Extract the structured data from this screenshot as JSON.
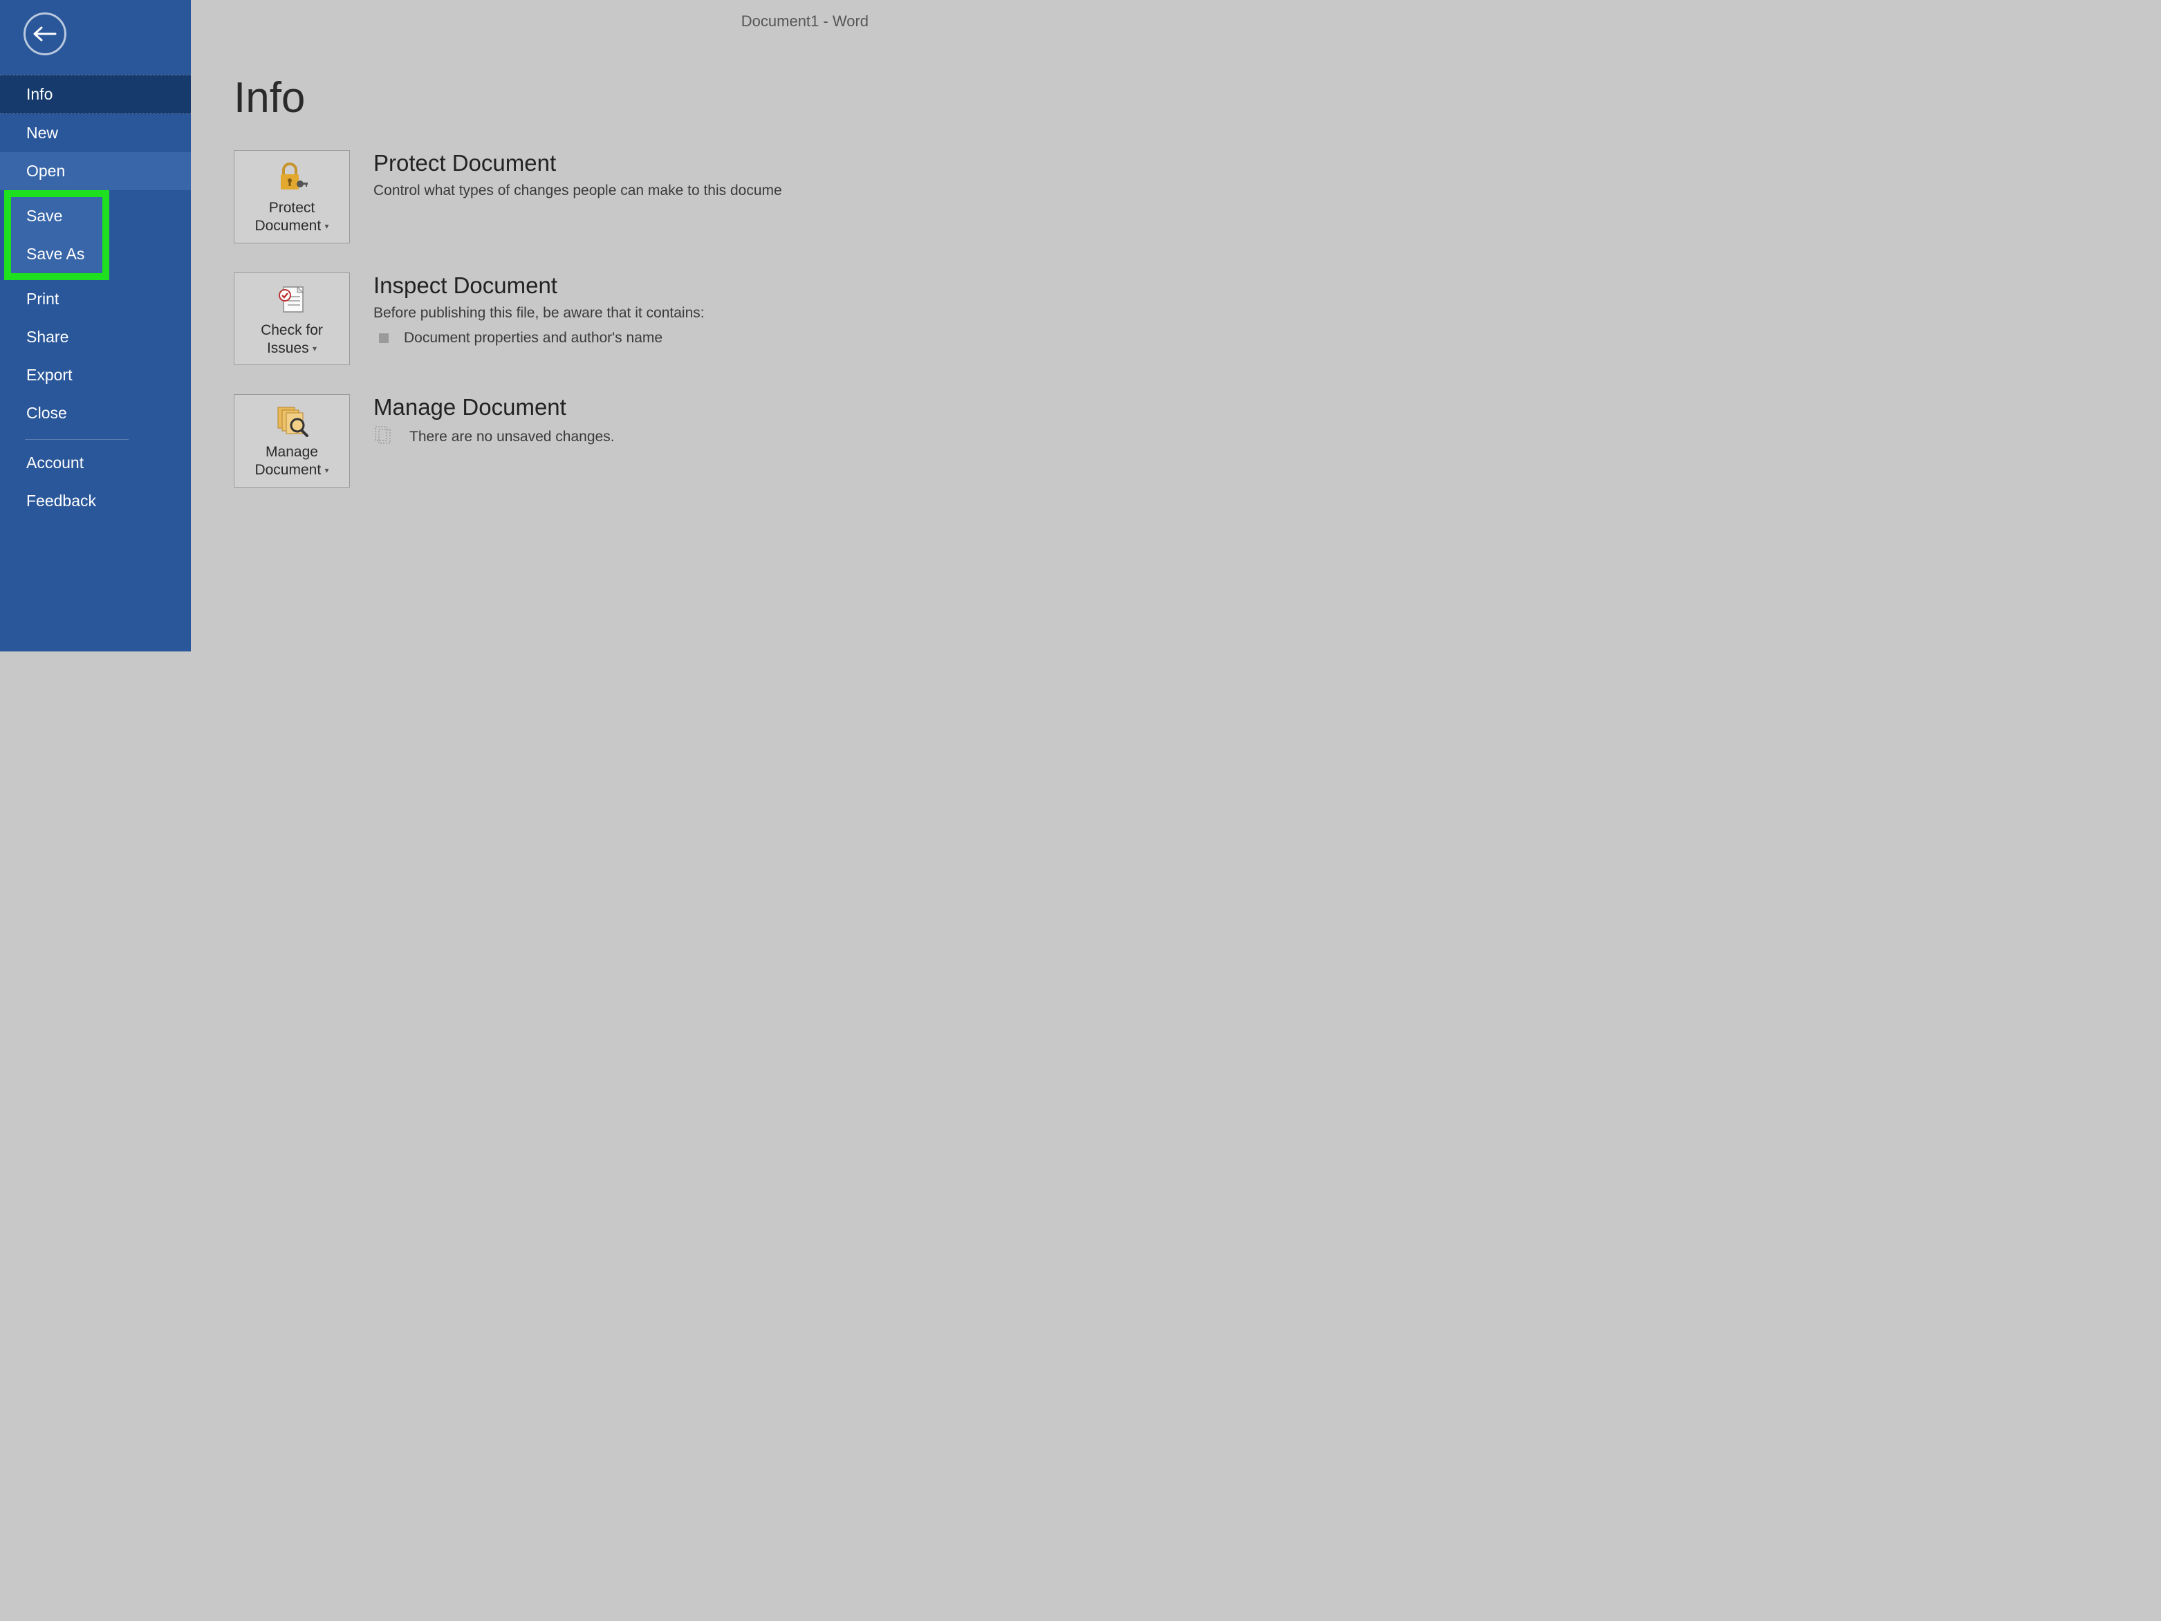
{
  "titlebar": {
    "text": "Document1  -  Word"
  },
  "sidebar": {
    "items": [
      {
        "label": "Info"
      },
      {
        "label": "New"
      },
      {
        "label": "Open"
      },
      {
        "label": "Save"
      },
      {
        "label": "Save As"
      },
      {
        "label": "Print"
      },
      {
        "label": "Share"
      },
      {
        "label": "Export"
      },
      {
        "label": "Close"
      },
      {
        "label": "Account"
      },
      {
        "label": "Feedback"
      }
    ]
  },
  "main": {
    "page_title": "Info",
    "protect": {
      "button_line1": "Protect",
      "button_line2": "Document",
      "heading": "Protect Document",
      "desc": "Control what types of changes people can make to this docume"
    },
    "inspect": {
      "button_line1": "Check for",
      "button_line2": "Issues",
      "heading": "Inspect Document",
      "desc": "Before publishing this file, be aware that it contains:",
      "bullet": "Document properties and author's name"
    },
    "manage": {
      "button_line1": "Manage",
      "button_line2": "Document",
      "heading": "Manage Document",
      "desc": "There are no unsaved changes."
    }
  }
}
